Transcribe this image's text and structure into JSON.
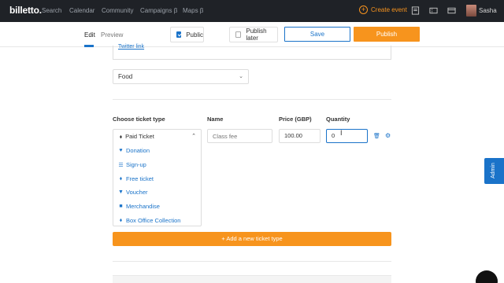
{
  "nav": {
    "logo": "billetto.",
    "links": [
      "Search",
      "Calendar",
      "Community",
      "Campaigns β",
      "Maps β"
    ],
    "create_event": "Create event",
    "username": "Sasha"
  },
  "toolbar": {
    "tabs": [
      "Edit",
      "Preview"
    ],
    "public_label": "Public",
    "public_checked": true,
    "publish_later_label": "Publish later",
    "publish_later_checked": false,
    "save_label": "Save",
    "publish_label": "Publish"
  },
  "form": {
    "twitter_link": "Twitter link",
    "category_value": "Food"
  },
  "ticket": {
    "headers": {
      "type": "Choose ticket type",
      "name": "Name",
      "price": "Price (GBP)",
      "quantity": "Quantity"
    },
    "selected_type": "Paid Ticket",
    "types": [
      {
        "label": "Donation",
        "icon": "heart-icon"
      },
      {
        "label": "Sign-up",
        "icon": "list-icon"
      },
      {
        "label": "Free ticket",
        "icon": "tag-icon"
      },
      {
        "label": "Voucher",
        "icon": "trophy-icon"
      },
      {
        "label": "Merchandise",
        "icon": "gift-icon"
      },
      {
        "label": "Box Office Collection",
        "icon": "tag-icon"
      }
    ],
    "name_placeholder": "Class fee",
    "price_value": "100.00",
    "quantity_value": "0",
    "add_label": "+ Add a new ticket type"
  },
  "sidebar_tab": "Admin",
  "colors": {
    "accent_orange": "#f7941d",
    "link_blue": "#1a73c9",
    "nav_bg": "#1f2227"
  }
}
